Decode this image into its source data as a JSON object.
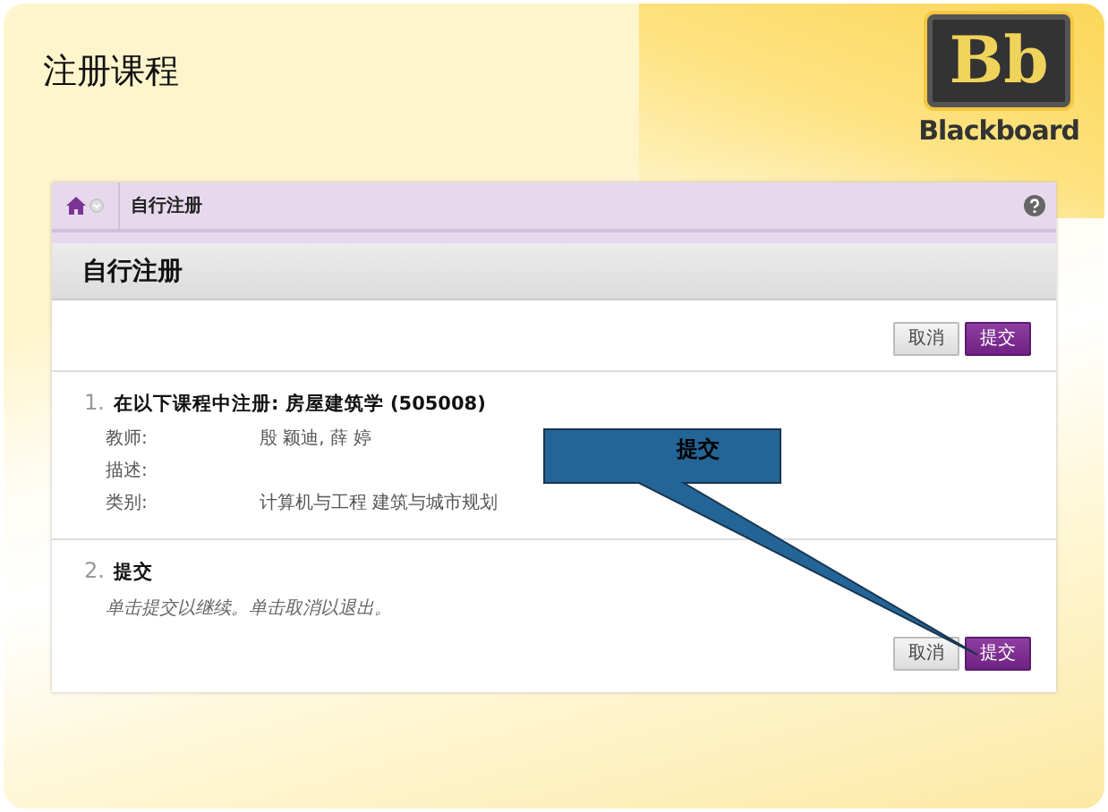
{
  "slide": {
    "title": "注册课程",
    "logo_letters": "Bb",
    "logo_text": "Blackboard"
  },
  "breadcrumb": {
    "items": [
      "自行注册"
    ]
  },
  "page_title": "自行注册",
  "top_buttons": [
    {
      "label": "取消",
      "kind": "cancel"
    },
    {
      "label": "提交",
      "kind": "submit"
    }
  ],
  "steps": [
    {
      "number": "1.",
      "title": "在以下课程中注册: 房屋建筑学 (505008)",
      "fields": [
        {
          "label": "教师:",
          "value": "殷 颖迪, 薛 婷"
        },
        {
          "label": "描述:"
        },
        {
          "label": "类别:",
          "value": "计算机与工程 建筑与城市规划"
        }
      ]
    },
    {
      "number": "2.",
      "title": "提交",
      "note": "单击提交以继续。单击取消以退出。"
    }
  ],
  "bottom_buttons": [
    {
      "label": "取消",
      "kind": "cancel"
    },
    {
      "label": "提交",
      "kind": "submit"
    }
  ],
  "callout": {
    "text": "提交"
  }
}
